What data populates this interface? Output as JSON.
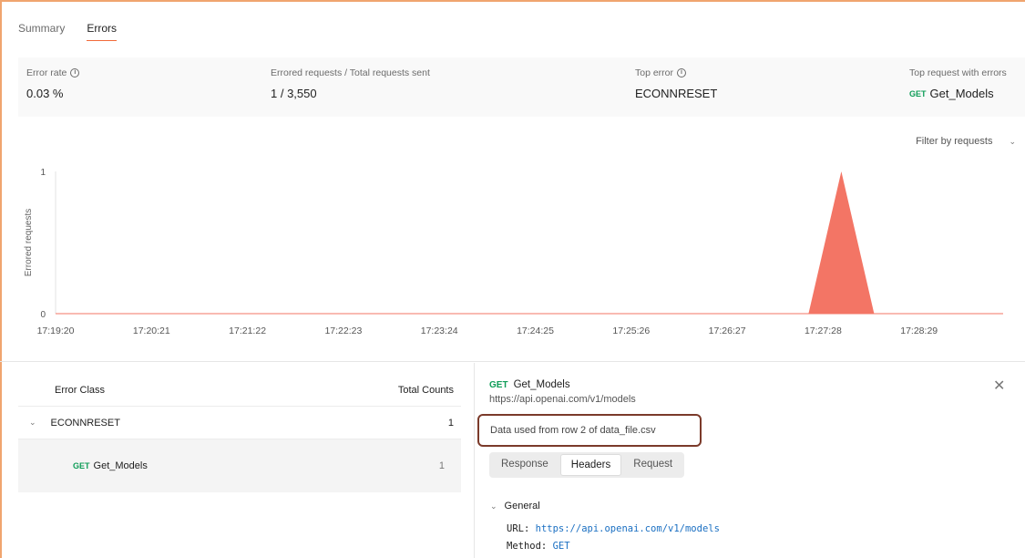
{
  "tabs": [
    {
      "label": "Summary",
      "active": false
    },
    {
      "label": "Errors",
      "active": true
    }
  ],
  "metrics": {
    "error_rate": {
      "label": "Error rate",
      "value": "0.03 %"
    },
    "errored_total": {
      "label": "Errored requests / Total requests sent",
      "value": "1 / 3,550"
    },
    "top_error": {
      "label": "Top error",
      "value": "ECONNRESET"
    },
    "top_request": {
      "label": "Top request with errors",
      "method": "GET",
      "value": "Get_Models"
    }
  },
  "filter": {
    "label": "Filter by requests"
  },
  "chart_data": {
    "type": "area",
    "ylabel": "Errored requests",
    "xlabel": "",
    "ylim": [
      0,
      1
    ],
    "yticks": [
      0,
      1
    ],
    "x": [
      "17:19:20",
      "17:20:21",
      "17:21:22",
      "17:22:23",
      "17:23:24",
      "17:24:25",
      "17:25:26",
      "17:26:27",
      "17:27:28",
      "17:28:29"
    ],
    "series": [
      {
        "values": [
          0,
          0,
          0,
          0,
          0,
          0,
          0,
          0,
          1,
          0
        ],
        "color": "#f37565"
      }
    ]
  },
  "error_table": {
    "col_class": "Error Class",
    "col_count": "Total Counts",
    "rows": [
      {
        "name": "ECONNRESET",
        "count": "1",
        "children": [
          {
            "method": "GET",
            "name": "Get_Models",
            "count": "1"
          }
        ]
      }
    ]
  },
  "detail": {
    "method": "GET",
    "name": "Get_Models",
    "url": "https://api.openai.com/v1/models",
    "data_note": "Data used from row 2 of data_file.csv",
    "segments": [
      {
        "label": "Response",
        "active": false
      },
      {
        "label": "Headers",
        "active": true
      },
      {
        "label": "Request",
        "active": false
      }
    ],
    "general_label": "General",
    "url_key": "URL:",
    "url_value": "https://api.openai.com/v1/models",
    "method_key": "Method:",
    "method_value": "GET"
  },
  "colors": {
    "accent": "#f26b3a",
    "area": "#f37565",
    "get_method": "#0f9d58",
    "note_border": "#7b3a2a"
  }
}
